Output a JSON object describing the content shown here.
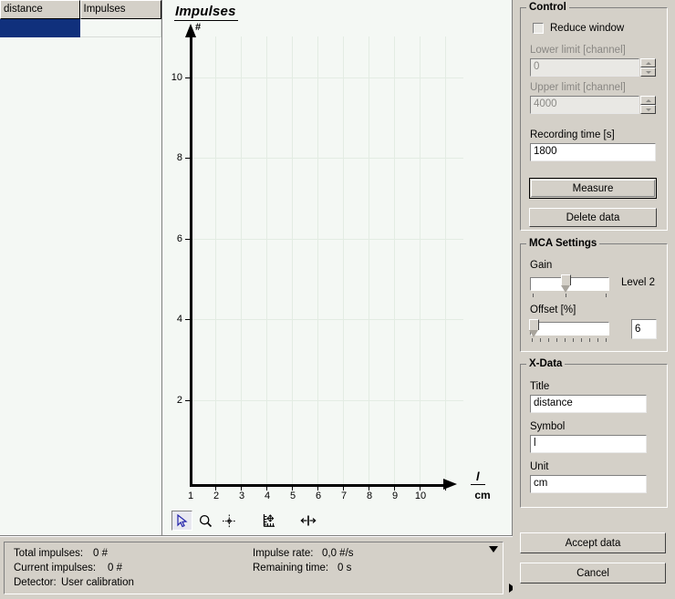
{
  "table": {
    "columns": [
      "distance",
      "Impulses"
    ],
    "rows": [
      {
        "distance": "",
        "impulses": "",
        "selected": true
      }
    ]
  },
  "chart": {
    "title": "Impulses",
    "y_unit": "#",
    "y_ticks": [
      "2",
      "4",
      "6",
      "8",
      "10"
    ],
    "x_ticks": [
      "1",
      "2",
      "3",
      "4",
      "5",
      "6",
      "7",
      "8",
      "9",
      "10"
    ],
    "x_symbol": "l",
    "x_unit": "cm",
    "toolbar": [
      {
        "name": "cursor-arrow-icon",
        "active": true
      },
      {
        "name": "magnifier-icon",
        "active": false
      },
      {
        "name": "crosshair-icon",
        "active": false
      },
      {
        "name": "axis-scale-icon",
        "active": false
      },
      {
        "name": "horizontal-span-icon",
        "active": false
      }
    ]
  },
  "chart_data": {
    "type": "scatter",
    "title": "Impulses",
    "xlabel": "l",
    "xunit": "cm",
    "ylabel": "Impulses",
    "yunit": "#",
    "x": [],
    "y": [],
    "xlim": [
      0.5,
      10.5
    ],
    "ylim": [
      0,
      11
    ],
    "xticks": [
      1,
      2,
      3,
      4,
      5,
      6,
      7,
      8,
      9,
      10
    ],
    "yticks": [
      2,
      4,
      6,
      8,
      10
    ],
    "grid": true,
    "legend": "none"
  },
  "status": {
    "total_impulses_label": "Total impulses:",
    "total_impulses_value": "0 #",
    "current_impulses_label": "Current impulses:",
    "current_impulses_value": "0 #",
    "detector_label": "Detector:",
    "detector_value": "User calibration",
    "impulse_rate_label": "Impulse rate:",
    "impulse_rate_value": "0,0 #/s",
    "remaining_time_label": "Remaining time:",
    "remaining_time_value": "0 s"
  },
  "control": {
    "legend": "Control",
    "reduce_window_label": "Reduce window",
    "reduce_window_checked": false,
    "lower_limit_label": "Lower limit [channel]",
    "lower_limit_value": "0",
    "upper_limit_label": "Upper limit [channel]",
    "upper_limit_value": "4000",
    "recording_time_label": "Recording time [s]",
    "recording_time_value": "1800",
    "measure_label": "Measure",
    "delete_data_label": "Delete data"
  },
  "mca": {
    "legend": "MCA Settings",
    "gain_label": "Gain",
    "gain_level_text": "Level 2",
    "offset_label": "Offset [%]",
    "offset_value": "6"
  },
  "xdata": {
    "legend": "X-Data",
    "title_label": "Title",
    "title_value": "distance",
    "symbol_label": "Symbol",
    "symbol_value": "l",
    "unit_label": "Unit",
    "unit_value": "cm"
  },
  "footer": {
    "accept_label": "Accept data",
    "cancel_label": "Cancel"
  },
  "colors": {
    "face": "#d4d0c8",
    "plot_bg": "#f4f8f4",
    "grid": "#e3ece3",
    "selection": "#10307c"
  }
}
